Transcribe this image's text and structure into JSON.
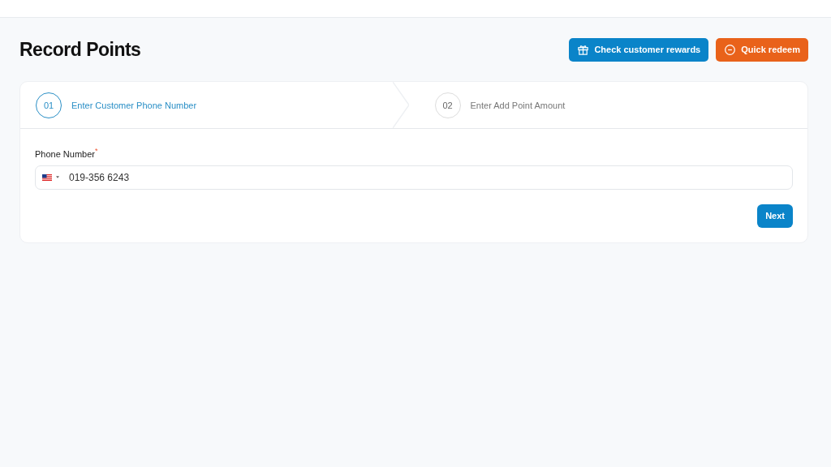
{
  "page_title": "Record Points",
  "actions": [
    {
      "label": "Check customer rewards",
      "kind": "gift"
    },
    {
      "label": "Quick redeem",
      "kind": "redeem"
    }
  ],
  "steps": [
    {
      "number": "01",
      "label": "Enter Customer Phone Number",
      "selected": true
    },
    {
      "number": "02",
      "label": "Enter Add Point Amount",
      "selected": false
    }
  ],
  "phone_field": {
    "label": "Phone Number",
    "required_mark": "*",
    "value": "019-356 6243"
  },
  "next_button": "Next"
}
